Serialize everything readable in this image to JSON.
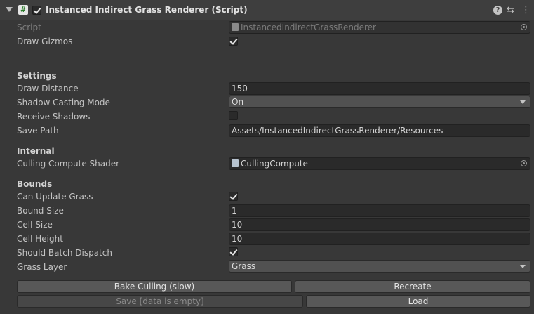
{
  "header": {
    "title": "Instanced Indirect Grass Renderer (Script)",
    "enabled": true,
    "help_glyph": "?",
    "settings_glyph": "⇆",
    "menu_glyph": "⋮"
  },
  "script_row": {
    "label": "Script",
    "value": "InstancedIndirectGrassRenderer"
  },
  "draw_gizmos": {
    "label": "Draw Gizmos",
    "checked": true
  },
  "settings": {
    "heading": "Settings",
    "draw_distance": {
      "label": "Draw Distance",
      "value": "150"
    },
    "shadow_casting_mode": {
      "label": "Shadow Casting Mode",
      "value": "On"
    },
    "receive_shadows": {
      "label": "Receive Shadows",
      "checked": false
    },
    "save_path": {
      "label": "Save Path",
      "value": "Assets/InstancedIndirectGrassRenderer/Resources"
    }
  },
  "internal": {
    "heading": "Internal",
    "culling_compute_shader": {
      "label": "Culling Compute Shader",
      "value": "CullingCompute"
    }
  },
  "bounds": {
    "heading": "Bounds",
    "can_update_grass": {
      "label": "Can Update Grass",
      "checked": true
    },
    "bound_size": {
      "label": "Bound Size",
      "value": "1"
    },
    "cell_size": {
      "label": "Cell Size",
      "value": "10"
    },
    "cell_height": {
      "label": "Cell Height",
      "value": "10"
    },
    "should_batch_dispatch": {
      "label": "Should Batch Dispatch",
      "checked": true
    },
    "grass_layer": {
      "label": "Grass Layer",
      "value": "Grass"
    }
  },
  "buttons": {
    "bake_culling": "Bake Culling (slow)",
    "recreate": "Recreate",
    "save": "Save [data is empty]",
    "load": "Load"
  },
  "colors": {
    "background": "#383838",
    "field": "#2a2a2a",
    "button": "#585858",
    "text": "#c4c4c4"
  }
}
